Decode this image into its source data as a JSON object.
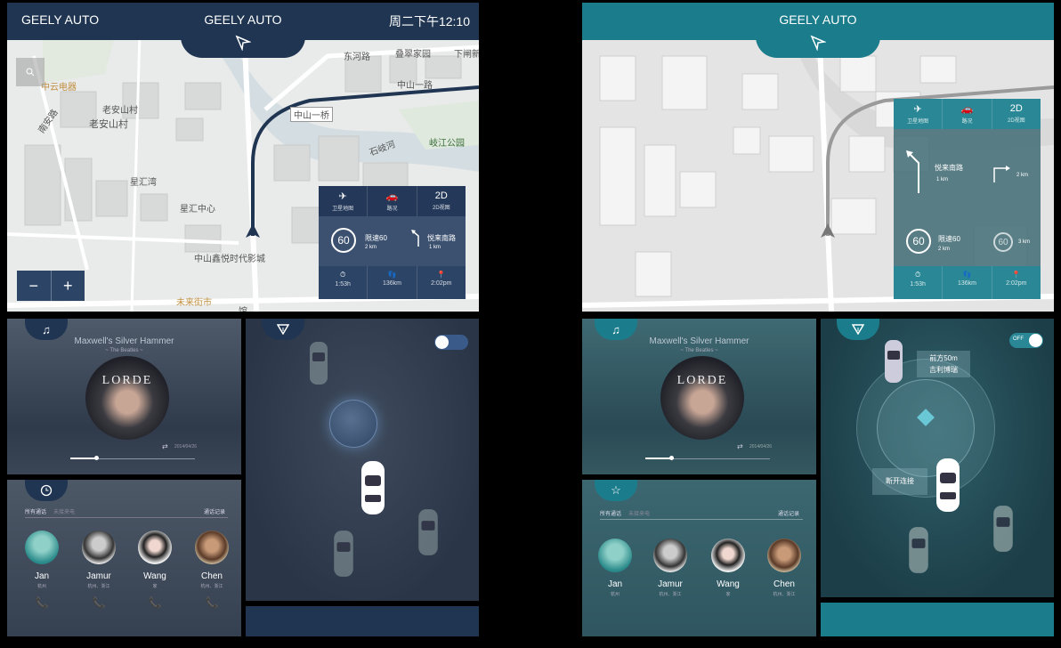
{
  "left": {
    "header": {
      "brand_left": "GEELY AUTO",
      "brand_center": "GEELY AUTO",
      "clock": "周二下午12:10"
    },
    "map_labels": [
      "东河路",
      "叠翠家园",
      "下闸新",
      "中云电器",
      "中山一路",
      "老安山村",
      "老安山村",
      "南安路",
      "中山一桥",
      "石岐河",
      "岐江公园",
      "星汇湾",
      "星汇中心",
      "中山鑫悦时代影城",
      "未来街市",
      "馆"
    ],
    "zoom": {
      "minus": "−",
      "plus": "+"
    },
    "nav_panel": {
      "modes": [
        {
          "label": "卫星地图"
        },
        {
          "label": "路况"
        },
        {
          "main": "2D",
          "label": "2D视图"
        }
      ],
      "speed": "60",
      "limit_text": "限速60",
      "limit_dist": "2 km",
      "turn_road": "悦来南路",
      "turn_dist": "1 km",
      "stats": [
        "1:53h",
        "136km",
        "2:02pm"
      ]
    },
    "music": {
      "title": "Maxwell's Silver Hammer",
      "artist": "~ The Beatles ~",
      "album_text": "LORDE",
      "date": "2014/04/26",
      "progress": 0.2
    },
    "calls": {
      "tab_all": "所有通话",
      "tab_missed": "未接来电",
      "log": "通话记录",
      "contacts": [
        {
          "name": "Jan",
          "sub": "杭州"
        },
        {
          "name": "Jamur",
          "sub": "杭州、浙江"
        },
        {
          "name": "Wang",
          "sub": "家"
        },
        {
          "name": "Chen",
          "sub": "杭州、浙江"
        }
      ]
    }
  },
  "right": {
    "header": {
      "brand_center": "GEELY AUTO"
    },
    "nav_panel": {
      "modes": [
        {
          "label": "卫星地图"
        },
        {
          "label": "路况"
        },
        {
          "main": "2D",
          "label": "2D视图"
        }
      ],
      "road1": "悦来南路",
      "road1_dist": "1 km",
      "road2_dist": "2 km",
      "speed": "60",
      "limit_text": "限速60",
      "limit_dist": "2 km",
      "speed2": "60",
      "speed2_dist": "3 km",
      "stats": [
        "1:53h",
        "136km",
        "2:02pm"
      ]
    },
    "music": {
      "title": "Maxwell's Silver Hammer",
      "artist": "~ The Beatles ~",
      "album_text": "LORDE",
      "date": "2014/04/26",
      "progress": 0.2
    },
    "calls": {
      "tab_all": "所有通话",
      "tab_missed": "未接来电",
      "log": "通话记录",
      "contacts": [
        {
          "name": "Jan",
          "sub": "杭州"
        },
        {
          "name": "Jamur",
          "sub": "杭州、浙江"
        },
        {
          "name": "Wang",
          "sub": "家"
        },
        {
          "name": "Chen",
          "sub": "杭州、浙江"
        }
      ]
    },
    "radar": {
      "toggle": "OFF",
      "front_dist": "前方50m",
      "front_car": "吉利博瑞",
      "disconnect": "断开连接"
    }
  },
  "colors": {
    "left_header": "#1f3552",
    "right_header": "#1b7d8c",
    "left_panel": "#2c4466",
    "right_panel": "#2a8896"
  }
}
